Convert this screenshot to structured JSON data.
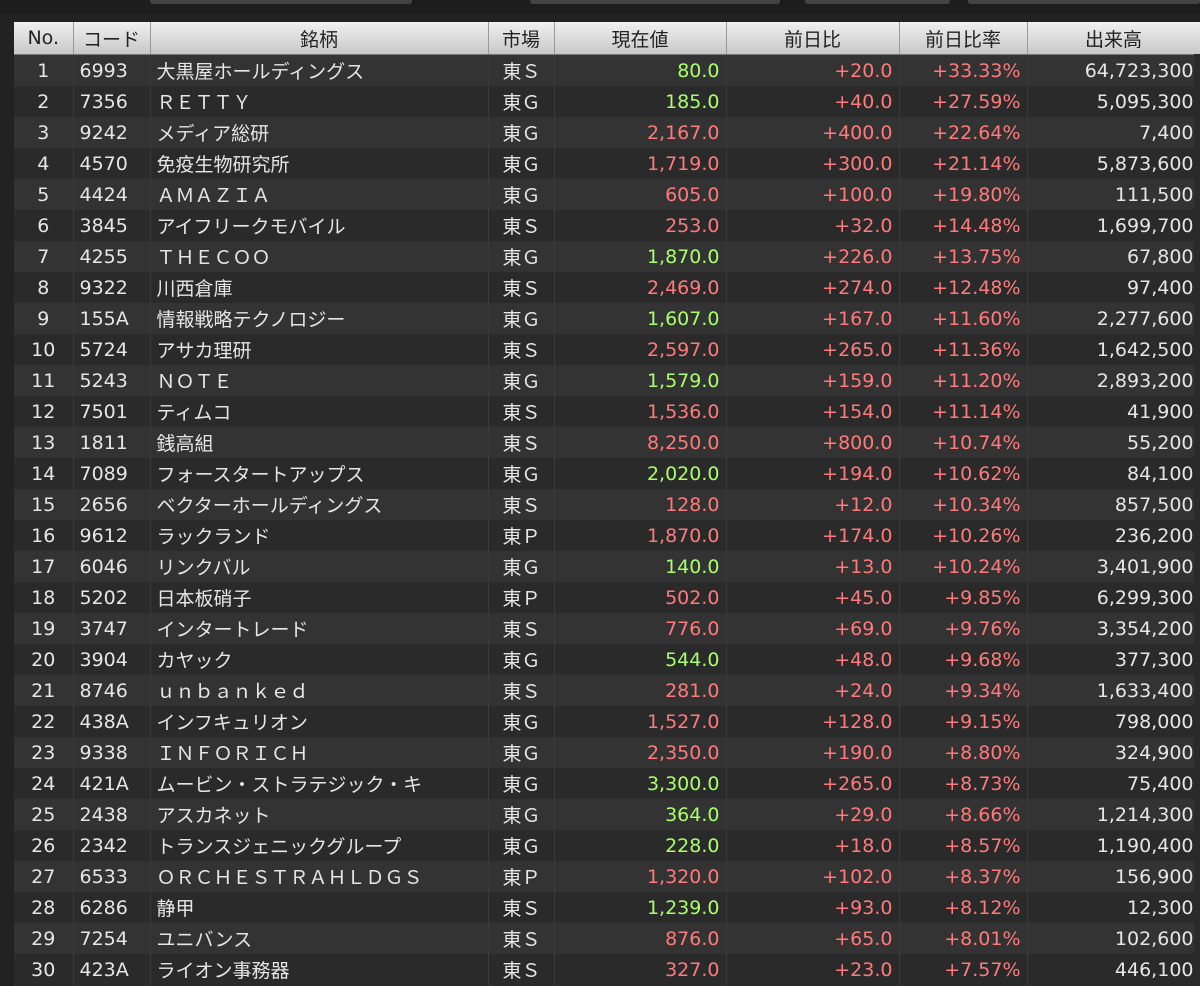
{
  "headers": [
    "No.",
    "コード",
    "銘柄",
    "市場",
    "現在値",
    "前日比",
    "前日比率",
    "出来高"
  ],
  "rows": [
    {
      "no": "1",
      "code": "6993",
      "name": "大黒屋ホールディングス",
      "market": "東Ｓ",
      "price": "80.0",
      "price_color": "green",
      "change": "+20.0",
      "rate": "+33.33%",
      "volume": "64,723,300"
    },
    {
      "no": "2",
      "code": "7356",
      "name": "ＲＥＴＴＹ",
      "market": "東Ｇ",
      "price": "185.0",
      "price_color": "green",
      "change": "+40.0",
      "rate": "+27.59%",
      "volume": "5,095,300"
    },
    {
      "no": "3",
      "code": "9242",
      "name": "メディア総研",
      "market": "東Ｇ",
      "price": "2,167.0",
      "price_color": "red",
      "change": "+400.0",
      "rate": "+22.64%",
      "volume": "7,400"
    },
    {
      "no": "4",
      "code": "4570",
      "name": "免疫生物研究所",
      "market": "東Ｇ",
      "price": "1,719.0",
      "price_color": "red",
      "change": "+300.0",
      "rate": "+21.14%",
      "volume": "5,873,600"
    },
    {
      "no": "5",
      "code": "4424",
      "name": "ＡＭＡＺＩＡ",
      "market": "東Ｇ",
      "price": "605.0",
      "price_color": "red",
      "change": "+100.0",
      "rate": "+19.80%",
      "volume": "111,500"
    },
    {
      "no": "6",
      "code": "3845",
      "name": "アイフリークモバイル",
      "market": "東Ｓ",
      "price": "253.0",
      "price_color": "red",
      "change": "+32.0",
      "rate": "+14.48%",
      "volume": "1,699,700"
    },
    {
      "no": "7",
      "code": "4255",
      "name": "ＴＨＥＣＯＯ",
      "market": "東Ｇ",
      "price": "1,870.0",
      "price_color": "green",
      "change": "+226.0",
      "rate": "+13.75%",
      "volume": "67,800"
    },
    {
      "no": "8",
      "code": "9322",
      "name": "川西倉庫",
      "market": "東Ｓ",
      "price": "2,469.0",
      "price_color": "red",
      "change": "+274.0",
      "rate": "+12.48%",
      "volume": "97,400"
    },
    {
      "no": "9",
      "code": "155A",
      "name": "情報戦略テクノロジー",
      "market": "東Ｇ",
      "price": "1,607.0",
      "price_color": "green",
      "change": "+167.0",
      "rate": "+11.60%",
      "volume": "2,277,600"
    },
    {
      "no": "10",
      "code": "5724",
      "name": "アサカ理研",
      "market": "東Ｓ",
      "price": "2,597.0",
      "price_color": "red",
      "change": "+265.0",
      "rate": "+11.36%",
      "volume": "1,642,500"
    },
    {
      "no": "11",
      "code": "5243",
      "name": "ＮＯＴＥ",
      "market": "東Ｇ",
      "price": "1,579.0",
      "price_color": "green",
      "change": "+159.0",
      "rate": "+11.20%",
      "volume": "2,893,200"
    },
    {
      "no": "12",
      "code": "7501",
      "name": "ティムコ",
      "market": "東Ｓ",
      "price": "1,536.0",
      "price_color": "red",
      "change": "+154.0",
      "rate": "+11.14%",
      "volume": "41,900"
    },
    {
      "no": "13",
      "code": "1811",
      "name": "銭高組",
      "market": "東Ｓ",
      "price": "8,250.0",
      "price_color": "red",
      "change": "+800.0",
      "rate": "+10.74%",
      "volume": "55,200"
    },
    {
      "no": "14",
      "code": "7089",
      "name": "フォースタートアップス",
      "market": "東Ｇ",
      "price": "2,020.0",
      "price_color": "green",
      "change": "+194.0",
      "rate": "+10.62%",
      "volume": "84,100"
    },
    {
      "no": "15",
      "code": "2656",
      "name": "ベクターホールディングス",
      "market": "東Ｓ",
      "price": "128.0",
      "price_color": "red",
      "change": "+12.0",
      "rate": "+10.34%",
      "volume": "857,500"
    },
    {
      "no": "16",
      "code": "9612",
      "name": "ラックランド",
      "market": "東Ｐ",
      "price": "1,870.0",
      "price_color": "red",
      "change": "+174.0",
      "rate": "+10.26%",
      "volume": "236,200"
    },
    {
      "no": "17",
      "code": "6046",
      "name": "リンクバル",
      "market": "東Ｇ",
      "price": "140.0",
      "price_color": "green",
      "change": "+13.0",
      "rate": "+10.24%",
      "volume": "3,401,900"
    },
    {
      "no": "18",
      "code": "5202",
      "name": "日本板硝子",
      "market": "東Ｐ",
      "price": "502.0",
      "price_color": "red",
      "change": "+45.0",
      "rate": "+9.85%",
      "volume": "6,299,300"
    },
    {
      "no": "19",
      "code": "3747",
      "name": "インタートレード",
      "market": "東Ｓ",
      "price": "776.0",
      "price_color": "red",
      "change": "+69.0",
      "rate": "+9.76%",
      "volume": "3,354,200"
    },
    {
      "no": "20",
      "code": "3904",
      "name": "カヤック",
      "market": "東Ｇ",
      "price": "544.0",
      "price_color": "green",
      "change": "+48.0",
      "rate": "+9.68%",
      "volume": "377,300"
    },
    {
      "no": "21",
      "code": "8746",
      "name": "ｕｎｂａｎｋｅｄ",
      "market": "東Ｓ",
      "price": "281.0",
      "price_color": "red",
      "change": "+24.0",
      "rate": "+9.34%",
      "volume": "1,633,400"
    },
    {
      "no": "22",
      "code": "438A",
      "name": "インフキュリオン",
      "market": "東Ｇ",
      "price": "1,527.0",
      "price_color": "red",
      "change": "+128.0",
      "rate": "+9.15%",
      "volume": "798,000"
    },
    {
      "no": "23",
      "code": "9338",
      "name": "ＩＮＦＯＲＩＣＨ",
      "market": "東Ｇ",
      "price": "2,350.0",
      "price_color": "red",
      "change": "+190.0",
      "rate": "+8.80%",
      "volume": "324,900"
    },
    {
      "no": "24",
      "code": "421A",
      "name": "ムービン・ストラテジック・キ",
      "market": "東Ｇ",
      "price": "3,300.0",
      "price_color": "green",
      "change": "+265.0",
      "rate": "+8.73%",
      "volume": "75,400"
    },
    {
      "no": "25",
      "code": "2438",
      "name": "アスカネット",
      "market": "東Ｇ",
      "price": "364.0",
      "price_color": "green",
      "change": "+29.0",
      "rate": "+8.66%",
      "volume": "1,214,300"
    },
    {
      "no": "26",
      "code": "2342",
      "name": "トランスジェニックグループ",
      "market": "東Ｇ",
      "price": "228.0",
      "price_color": "green",
      "change": "+18.0",
      "rate": "+8.57%",
      "volume": "1,190,400"
    },
    {
      "no": "27",
      "code": "6533",
      "name": "ＯＲＣＨＥＳＴＲＡＨＬＤＧＳ",
      "market": "東Ｐ",
      "price": "1,320.0",
      "price_color": "red",
      "change": "+102.0",
      "rate": "+8.37%",
      "volume": "156,900"
    },
    {
      "no": "28",
      "code": "6286",
      "name": "静甲",
      "market": "東Ｓ",
      "price": "1,239.0",
      "price_color": "green",
      "change": "+93.0",
      "rate": "+8.12%",
      "volume": "12,300"
    },
    {
      "no": "29",
      "code": "7254",
      "name": "ユニバンス",
      "market": "東Ｓ",
      "price": "876.0",
      "price_color": "red",
      "change": "+65.0",
      "rate": "+8.01%",
      "volume": "102,600"
    },
    {
      "no": "30",
      "code": "423A",
      "name": "ライオン事務器",
      "market": "東Ｓ",
      "price": "327.0",
      "price_color": "red",
      "change": "+23.0",
      "rate": "+7.57%",
      "volume": "446,100"
    }
  ],
  "colors": {
    "green": "#a8ff6a",
    "red": "#ff7a7a"
  }
}
